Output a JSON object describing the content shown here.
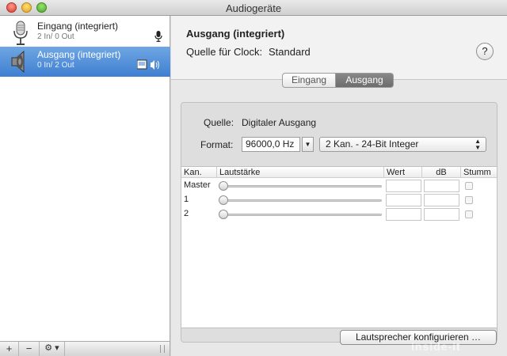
{
  "window": {
    "title": "Audiogeräte"
  },
  "sidebar": {
    "devices": [
      {
        "name": "Eingang (integriert)",
        "io": "2 In/ 0 Out",
        "icon": "microphone-icon",
        "selected": false
      },
      {
        "name": "Ausgang (integriert)",
        "io": "0 In/ 2 Out",
        "icon": "speaker-icon",
        "selected": true
      }
    ],
    "toolbar": {
      "add": "+",
      "remove": "−",
      "gear": "⚙ ▾"
    }
  },
  "main": {
    "device_title": "Ausgang (integriert)",
    "clock_label": "Quelle für Clock:",
    "clock_value": "Standard",
    "help": "?",
    "tabs": [
      {
        "label": "Eingang",
        "active": false
      },
      {
        "label": "Ausgang",
        "active": true
      }
    ],
    "source_label": "Quelle:",
    "source_value": "Digitaler Ausgang",
    "format_label": "Format:",
    "sample_rate": "96000,0 Hz",
    "channel_format": "2 Kan. - 24-Bit Integer",
    "table": {
      "headers": {
        "channel": "Kan.",
        "volume": "Lautstärke",
        "value": "Wert",
        "db": "dB",
        "mute": "Stumm"
      },
      "rows": [
        {
          "label": "Master",
          "volume": 0,
          "value": "",
          "db": "",
          "muted": false
        },
        {
          "label": "1",
          "volume": 0,
          "value": "",
          "db": "",
          "muted": false
        },
        {
          "label": "2",
          "volume": 0,
          "value": "",
          "db": "",
          "muted": false
        }
      ]
    },
    "configure_button": "Lautsprecher konfigurieren …"
  },
  "watermark": "inside-it"
}
